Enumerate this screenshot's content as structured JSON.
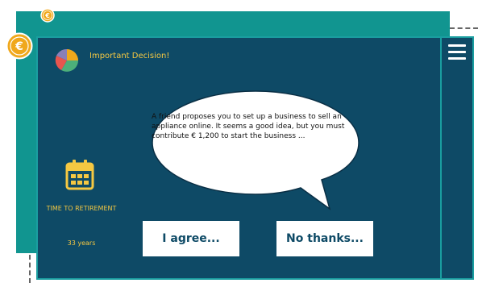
{
  "header": {
    "title": "Important Decision!"
  },
  "dialog": {
    "message": "A friend proposes you to set up a business to sell an appliance online. It seems a good idea, but you must contribute € 1,200 to start the business ..."
  },
  "retirement": {
    "label": "TIME TO RETIREMENT",
    "value": "33 years"
  },
  "actions": {
    "agree_label": "I agree...",
    "decline_label": "No thanks..."
  },
  "coins": {
    "symbol": "€"
  },
  "icons": {
    "coin": "euro-coin-icon",
    "pie": "pie-chart-icon",
    "calendar": "calendar-icon",
    "menu": "hamburger-menu-icon"
  },
  "colors": {
    "panel": "#0e4a66",
    "teal": "#119590",
    "accent": "#f5c842",
    "button_bg": "#ffffff",
    "button_text": "#0e4a66"
  }
}
